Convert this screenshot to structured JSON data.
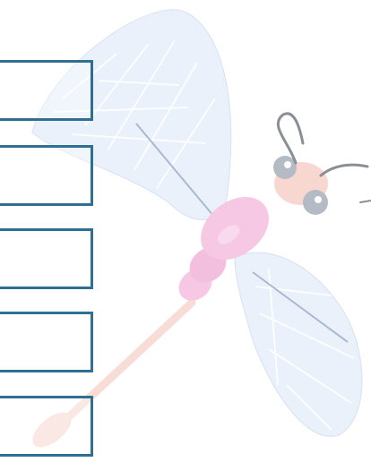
{
  "illustration": {
    "subject": "dragonfly",
    "colors": {
      "wing_fill": "#eaf1fb",
      "wing_vein": "#ffffff",
      "wing_spar": "#a9b8d3",
      "body_pink": "#f6c8e4",
      "tail_peach": "#f8dcd6",
      "face": "#f7d7cf",
      "eye": "#b4bbc5",
      "eye_highlight": "#ffffff",
      "antenna": "#8a8f96",
      "box_border": "#2f6f94"
    }
  },
  "answer_boxes": [
    {
      "value": ""
    },
    {
      "value": ""
    },
    {
      "value": ""
    },
    {
      "value": ""
    },
    {
      "value": ""
    }
  ]
}
